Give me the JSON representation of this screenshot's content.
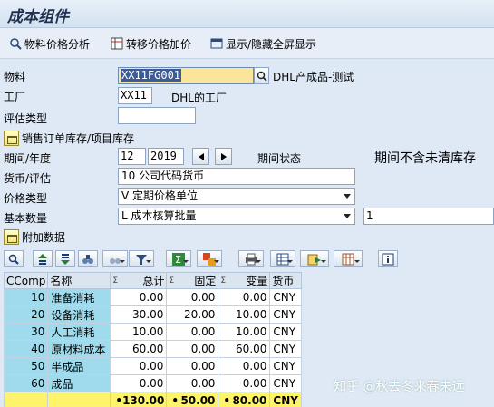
{
  "title": "成本组件",
  "toolbar": {
    "material_price_analysis": "物料价格分析",
    "transfer_price_extra": "转移价格加价",
    "show_hide_fullscreen": "显示/隐藏全屏显示"
  },
  "form": {
    "material_label": "物料",
    "material_value": "XX11FG001",
    "material_desc": "DHL产成品-测试",
    "plant_label": "工厂",
    "plant_value": "XX11",
    "plant_desc": "DHL的工厂",
    "valuation_type_label": "评估类型",
    "valuation_type_value": "",
    "sales_order_stock_button": "销售订单库存/项目库存",
    "period_year_label": "期间/年度",
    "period_value": "12",
    "year_value": "2019",
    "period_status_label": "期间状态",
    "period_status_value": "期间不含未清库存",
    "currency_valuation_label": "货币/评估",
    "currency_valuation_value": "10 公司代码货币",
    "price_type_label": "价格类型",
    "price_type_value": "V 定期价格单位",
    "base_qty_label": "基本数量",
    "base_qty_value": "L 成本核算批量",
    "base_qty_number": "1",
    "additional_data_button": "附加数据"
  },
  "grid": {
    "columns": [
      "CComp",
      "名称",
      "总计",
      "固定",
      "变量",
      "货币"
    ],
    "sigma": "Σ",
    "rows": [
      {
        "ccomp": "10",
        "name": "准备消耗",
        "total": "0.00",
        "fixed": "0.00",
        "variable": "0.00",
        "currency": "CNY"
      },
      {
        "ccomp": "20",
        "name": "设备消耗",
        "total": "30.00",
        "fixed": "20.00",
        "variable": "10.00",
        "currency": "CNY"
      },
      {
        "ccomp": "30",
        "name": "人工消耗",
        "total": "10.00",
        "fixed": "0.00",
        "variable": "10.00",
        "currency": "CNY"
      },
      {
        "ccomp": "40",
        "name": "原材料成本",
        "total": "60.00",
        "fixed": "0.00",
        "variable": "60.00",
        "currency": "CNY"
      },
      {
        "ccomp": "50",
        "name": "半成品",
        "total": "0.00",
        "fixed": "0.00",
        "variable": "0.00",
        "currency": "CNY"
      },
      {
        "ccomp": "60",
        "name": "成品",
        "total": "0.00",
        "fixed": "0.00",
        "variable": "0.00",
        "currency": "CNY"
      }
    ],
    "totals": {
      "total": "130.00",
      "fixed": "50.00",
      "variable": "80.00",
      "currency": "CNY",
      "bullet": "•"
    }
  },
  "watermark": "知乎 @秋去冬来春未远",
  "colors": {
    "accent": "#3c5c97",
    "key_cell": "#9fdbec",
    "total_row": "#fdf46c",
    "background": "#dfe9f5"
  }
}
